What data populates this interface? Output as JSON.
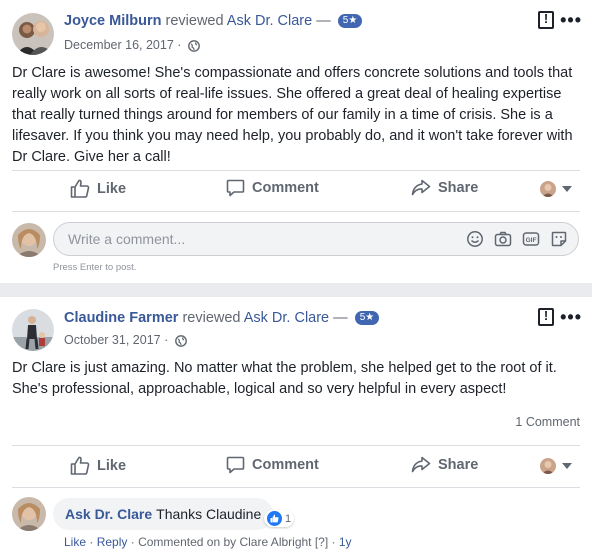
{
  "post1": {
    "author": "Joyce Milburn",
    "action": "reviewed",
    "page": "Ask Dr. Clare",
    "dash": "—",
    "rating": "5★",
    "date": "December 16, 2017",
    "dot": "·",
    "text": "Dr Clare is awesome! She's compassionate and offers concrete solutions and tools that really work on all sorts of real-life issues. She offered a great deal of healing expertise that really turned things around for members of our family in a time of crisis. She is a lifesaver. If you think you may need help, you probably do, and it won't take forever with Dr Clare. Give her a call!",
    "actions": {
      "like": "Like",
      "comment": "Comment",
      "share": "Share"
    },
    "comment_placeholder": "Write a comment...",
    "hint": "Press Enter to post."
  },
  "post2": {
    "author": "Claudine Farmer",
    "action": "reviewed",
    "page": "Ask Dr. Clare",
    "dash": "—",
    "rating": "5★",
    "date": "October 31, 2017",
    "dot": "·",
    "text": "Dr Clare is just amazing. No matter what the problem, she helped get to the root of it. She's professional, approachable, logical and so very helpful in every aspect!",
    "comment_count": "1 Comment",
    "actions": {
      "like": "Like",
      "comment": "Comment",
      "share": "Share"
    },
    "reply": {
      "author": "Ask Dr. Clare",
      "text": "Thanks Claudine",
      "reaction_count": "1",
      "like": "Like",
      "reply": "Reply",
      "sep": "·",
      "commented_on_by": "Commented on by Clare Albright",
      "flag": "[?]",
      "age": "1y"
    }
  },
  "colors": {
    "link": "#385898",
    "badge": "#4267b2",
    "muted": "#616770",
    "separator": "#e9ebee"
  },
  "icons": [
    "globe-icon",
    "report-flag-icon",
    "more-options-icon",
    "like-icon",
    "comment-icon",
    "share-icon",
    "emoji-icon",
    "camera-icon",
    "gif-icon",
    "sticker-icon",
    "like-reaction-icon"
  ]
}
